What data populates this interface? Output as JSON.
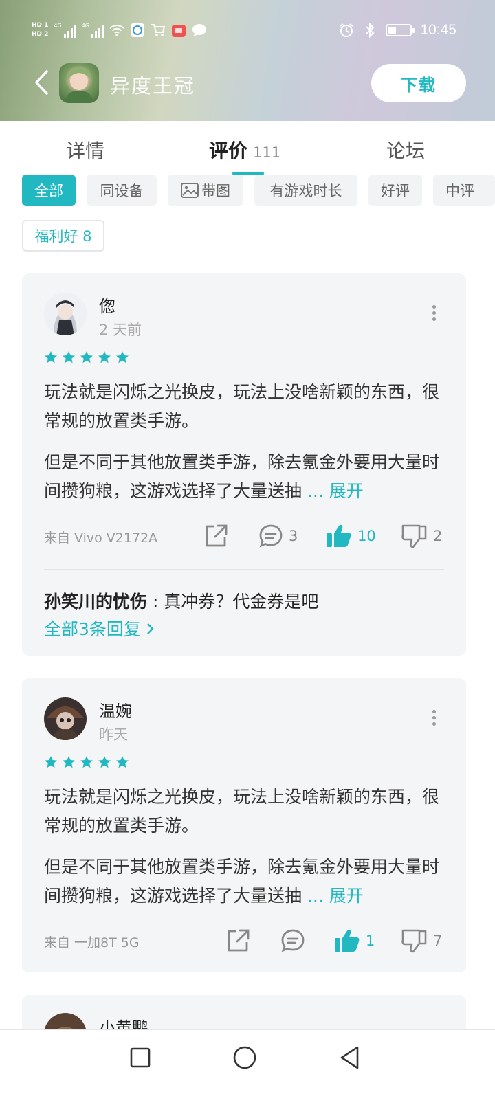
{
  "status_bar": {
    "hd1": "HD 1",
    "hd2": "HD 2",
    "net1": "4G",
    "net2": "4G",
    "time": "10:45",
    "icons": [
      "wifi-icon",
      "message-app-icon",
      "cart-icon",
      "gift-icon",
      "chat-bubble-icon",
      "alarm-icon",
      "bluetooth-icon",
      "battery-icon"
    ],
    "battery_level": 0.3
  },
  "app_header": {
    "title": "异度王冠",
    "download_label": "下载"
  },
  "tabs": [
    {
      "label": "详情"
    },
    {
      "label": "评价",
      "count": "111",
      "active": true
    },
    {
      "label": "论坛"
    }
  ],
  "filters": [
    {
      "label": "全部",
      "active": true
    },
    {
      "label": "同设备"
    },
    {
      "label": "带图",
      "icon": "image-icon"
    },
    {
      "label": "有游戏时长"
    },
    {
      "label": "好评"
    },
    {
      "label": "中评"
    },
    {
      "label": "福利好 8",
      "style": "outline"
    }
  ],
  "reviews": [
    {
      "username": "偬",
      "time": "2 天前",
      "rating": 5,
      "para1": "玩法就是闪烁之光换皮，玩法上没啥新颖的东西，很常规的放置类手游。",
      "para2": "但是不同于其他放置类手游，除去氪金外要用大量时间攒狗粮，这游戏选择了大量送抽",
      "expand_label": "... 展开",
      "device": "来自 Vivo V2172A",
      "comments": "3",
      "likes": "10",
      "dislikes": "2",
      "reply_user": "孙笑川的忧伤",
      "reply_text": ": 真冲券？代金券是吧",
      "reply_link": "全部3条回复"
    },
    {
      "username": "温婉",
      "time": "昨天",
      "rating": 5,
      "para1": "玩法就是闪烁之光换皮，玩法上没啥新颖的东西，很常规的放置类手游。",
      "para2": "但是不同于其他放置类手游，除去氪金外要用大量时间攒狗粮，这游戏选择了大量送抽",
      "expand_label": "... 展开",
      "device": "来自 一加8T 5G",
      "comments": "",
      "likes": "1",
      "dislikes": "7"
    },
    {
      "username": "小黄鹏"
    }
  ],
  "colors": {
    "accent": "#21b8c2",
    "card_bg": "#f4f5f7",
    "muted_text": "#999999"
  },
  "nav": [
    "recent-apps-icon",
    "home-icon",
    "back-triangle-icon"
  ]
}
